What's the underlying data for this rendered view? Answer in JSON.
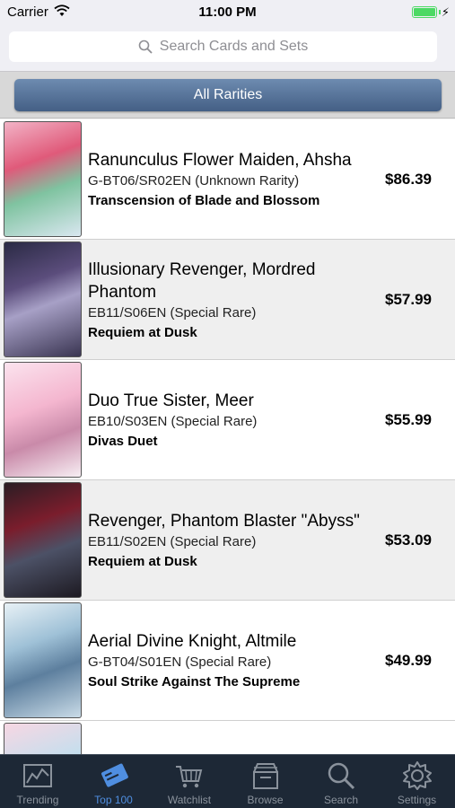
{
  "status_bar": {
    "carrier": "Carrier",
    "time": "11:00 PM"
  },
  "search": {
    "placeholder": "Search Cards and Sets"
  },
  "filter": {
    "label": "All Rarities"
  },
  "cards": [
    {
      "name": "Ranunculus Flower Maiden, Ahsha",
      "code": "G-BT06/SR02EN (Unknown Rarity)",
      "set": "Transcension of Blade and Blossom",
      "price": "$86.39"
    },
    {
      "name": "Illusionary Revenger, Mordred Phantom",
      "code": "EB11/S06EN (Special Rare)",
      "set": "Requiem at Dusk",
      "price": "$57.99"
    },
    {
      "name": "Duo True Sister, Meer",
      "code": "EB10/S03EN (Special Rare)",
      "set": "Divas Duet",
      "price": "$55.99"
    },
    {
      "name": "Revenger, Phantom Blaster \"Abyss\"",
      "code": "EB11/S02EN (Special Rare)",
      "set": "Requiem at Dusk",
      "price": "$53.09"
    },
    {
      "name": "Aerial Divine Knight, Altmile",
      "code": "G-BT04/S01EN (Special Rare)",
      "set": "Soul Strike Against The Supreme",
      "price": "$49.99"
    }
  ],
  "tabs": [
    {
      "label": "Trending",
      "icon": "chart-icon"
    },
    {
      "label": "Top 100",
      "icon": "cards-icon"
    },
    {
      "label": "Watchlist",
      "icon": "cart-icon"
    },
    {
      "label": "Browse",
      "icon": "box-icon"
    },
    {
      "label": "Search",
      "icon": "magnifier-icon"
    },
    {
      "label": "Settings",
      "icon": "gear-icon"
    }
  ],
  "active_tab": "Top 100",
  "colors": {
    "tab_active": "#4f8ee0",
    "tab_inactive": "#8a929c",
    "tab_bar_bg": "#1d2836",
    "filter_button": "#557399"
  }
}
